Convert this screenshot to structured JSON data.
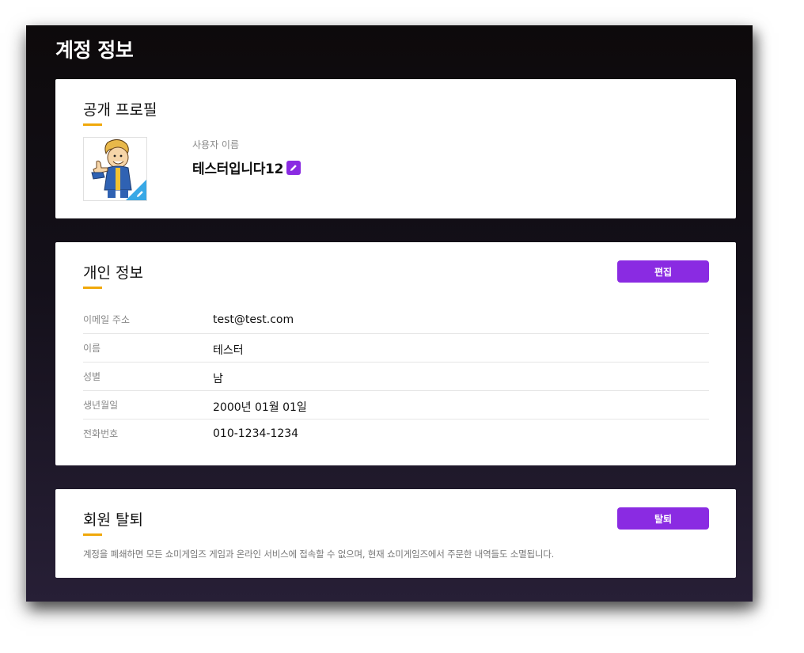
{
  "page": {
    "title": "계정 정보"
  },
  "profile": {
    "section_title": "공개 프로필",
    "username_label": "사용자 이름",
    "username": "테스터입니다12",
    "avatar_icon": "vault-boy-avatar",
    "edit_icon": "pencil-icon"
  },
  "personal": {
    "section_title": "개인 정보",
    "edit_button": "편집",
    "rows": [
      {
        "label": "이메일 주소",
        "value": "test@test.com"
      },
      {
        "label": "이름",
        "value": "테스터"
      },
      {
        "label": "성별",
        "value": "남"
      },
      {
        "label": "생년월일",
        "value": "2000년 01월 01일"
      },
      {
        "label": "전화번호",
        "value": "010-1234-1234"
      }
    ]
  },
  "withdraw": {
    "section_title": "회원 탈퇴",
    "button": "탈퇴",
    "description": "계정을 폐쇄하면 모든 쇼미게임즈 게임과 온라인 서비스에 접속할 수 없으며, 현재 쇼미게임즈에서 주문한 내역들도 소멸됩니다."
  },
  "colors": {
    "accent": "#8a2be2",
    "underline": "#f0a80a",
    "avatar_badge": "#38a8e6"
  }
}
